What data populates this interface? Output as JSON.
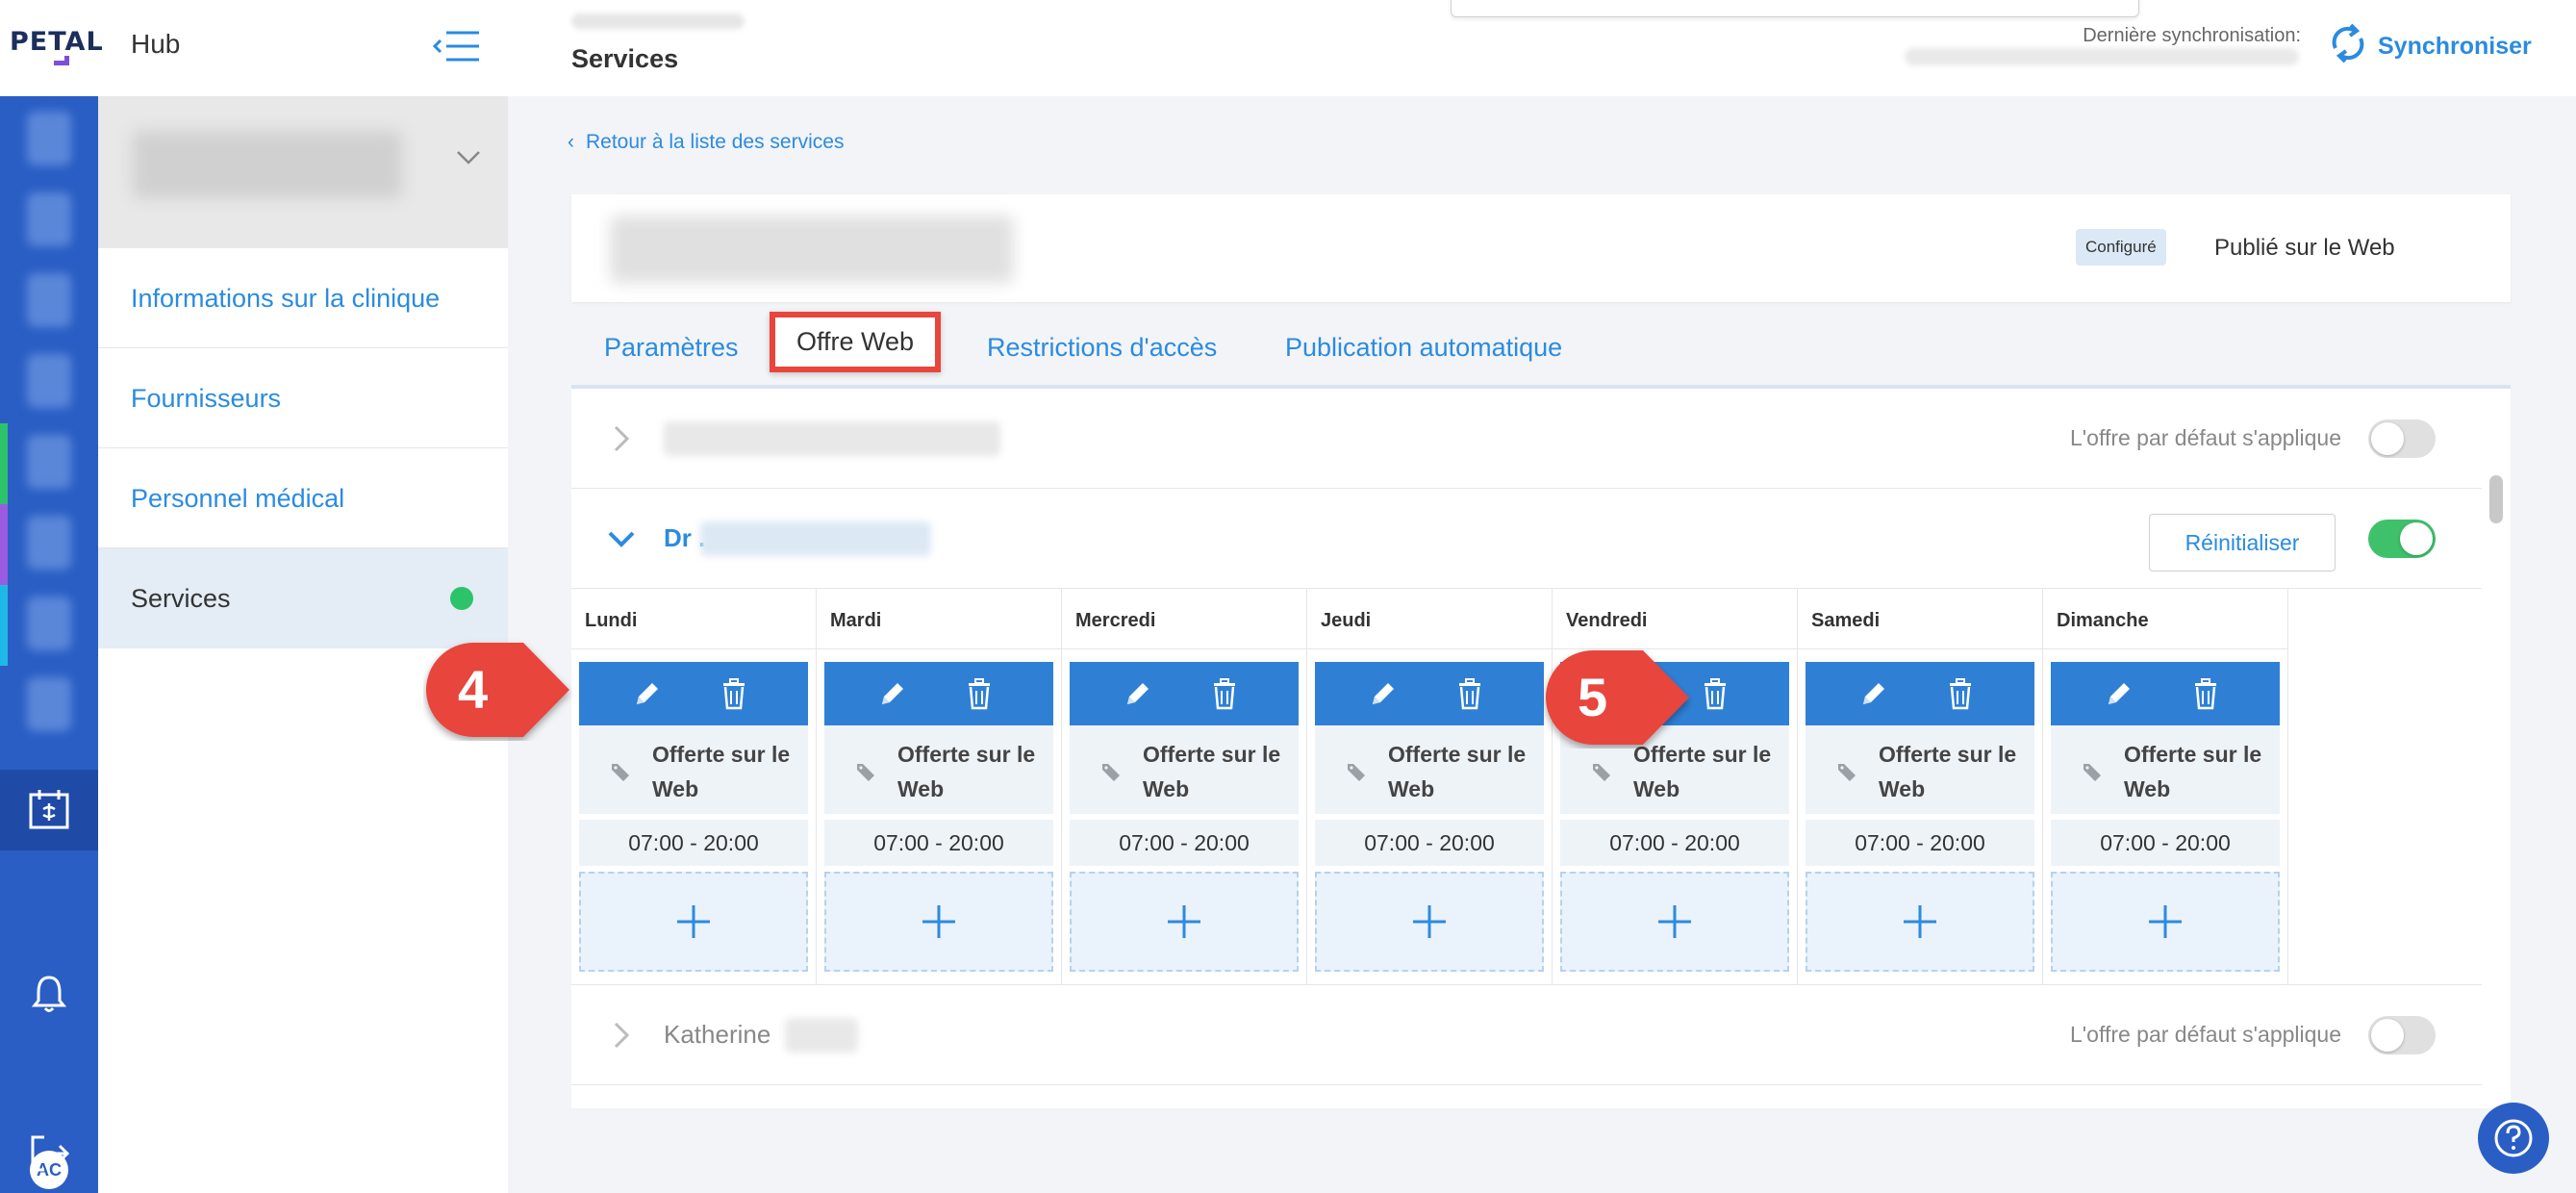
{
  "header": {
    "logo_text": "PETAL",
    "hub_title": "Hub",
    "page_title": "Services",
    "sync_label": "Dernière synchronisation:",
    "sync_button": "Synchroniser"
  },
  "rail": {
    "user_initials": "AC"
  },
  "sidebar": {
    "items": [
      {
        "label": "Informations sur la clinique"
      },
      {
        "label": "Fournisseurs"
      },
      {
        "label": "Personnel médical"
      },
      {
        "label": "Services"
      }
    ]
  },
  "main": {
    "back_link": "Retour à la liste des services",
    "status_badge": "Configuré",
    "published_label": "Publié sur le Web",
    "tabs": [
      {
        "label": "Paramètres"
      },
      {
        "label": "Offre Web"
      },
      {
        "label": "Restrictions d'accès"
      },
      {
        "label": "Publication automatique"
      }
    ],
    "default_offer_label": "L'offre par défaut s'applique",
    "reset_button": "Réinitialiser",
    "providers": [
      {
        "name": "",
        "default_offer_on": false
      },
      {
        "name": "Dr .",
        "default_offer_on": true
      },
      {
        "name": "Katherine",
        "default_offer_on": false
      }
    ],
    "days": [
      {
        "name": "Lundi",
        "offer": "Offerte sur le Web",
        "time": "07:00 - 20:00"
      },
      {
        "name": "Mardi",
        "offer": "Offerte sur le Web",
        "time": "07:00 - 20:00"
      },
      {
        "name": "Mercredi",
        "offer": "Offerte sur le Web",
        "time": "07:00 - 20:00"
      },
      {
        "name": "Jeudi",
        "offer": "Offerte sur le Web",
        "time": "07:00 - 20:00"
      },
      {
        "name": "Vendredi",
        "offer": "Offerte sur le Web",
        "time": "07:00 - 20:00"
      },
      {
        "name": "Samedi",
        "offer": "Offerte sur le Web",
        "time": "07:00 - 20:00"
      },
      {
        "name": "Dimanche",
        "offer": "Offerte sur le Web",
        "time": "07:00 - 20:00"
      }
    ]
  },
  "callouts": [
    {
      "number": "4"
    },
    {
      "number": "5"
    }
  ],
  "colors": {
    "accent": "#2b8be0",
    "rail": "#2a5ec4",
    "toggle_on": "#3ec16a",
    "callout": "#e8453c",
    "status_dot": "#2cc36b"
  }
}
